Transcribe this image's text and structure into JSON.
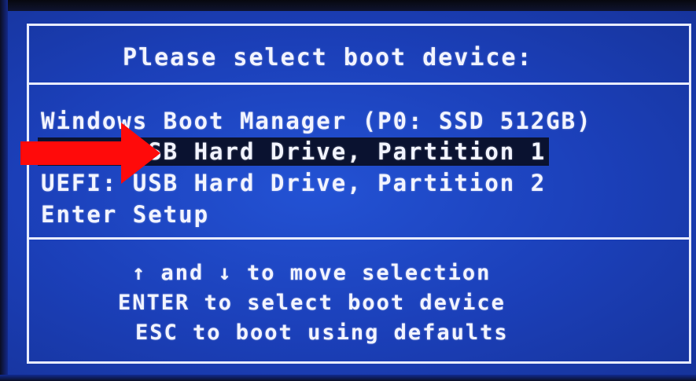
{
  "header": {
    "title": "Please select boot device:"
  },
  "boot_menu": {
    "items": [
      {
        "label": "Windows Boot Manager (P0: SSD 512GB)",
        "selected": false
      },
      {
        "label": "UEFI: USB Hard Drive, Partition 1",
        "selected": true
      },
      {
        "label": "UEFI: USB Hard Drive, Partition 2",
        "selected": false
      },
      {
        "label": "Enter Setup",
        "selected": false
      }
    ]
  },
  "help": {
    "line1": "↑ and ↓ to move selection",
    "line2": "ENTER to select boot device",
    "line3": "ESC to boot using defaults"
  },
  "colors": {
    "background": "#1a3fbf",
    "text": "#f2f4ff",
    "selection_background": "#0a1230",
    "annotation_arrow": "#ff0a0a"
  },
  "annotation": {
    "icon": "red-arrow-right-icon"
  }
}
